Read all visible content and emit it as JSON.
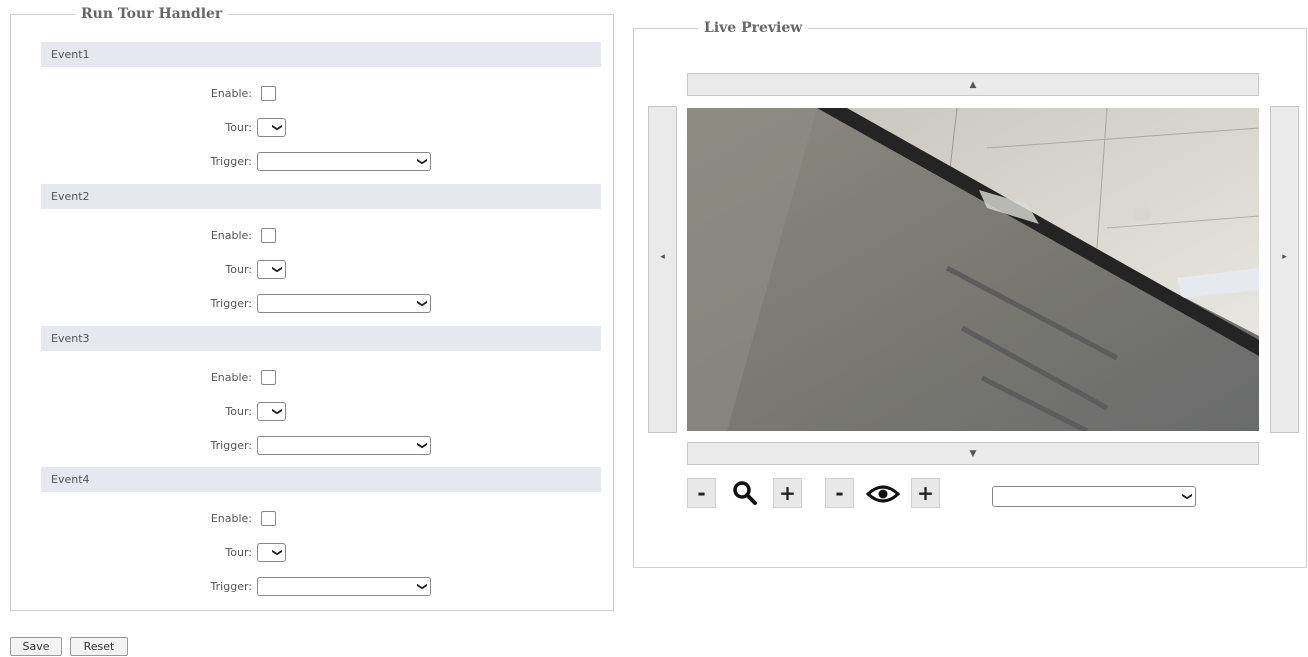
{
  "handler": {
    "title": "Run Tour Handler",
    "enable_label": "Enable:",
    "tour_label": "Tour:",
    "trigger_label": "Trigger:",
    "events": [
      {
        "name": "Event1",
        "trigger_value": ""
      },
      {
        "name": "Event2",
        "trigger_value": ""
      },
      {
        "name": "Event3",
        "trigger_value": ""
      },
      {
        "name": "Event4",
        "trigger_value": ""
      }
    ]
  },
  "preview": {
    "title": "Live Preview",
    "zoom_minus": "-",
    "zoom_plus": "+",
    "focus_minus": "-",
    "focus_plus": "+",
    "preset_value": ""
  },
  "buttons": {
    "save": "Save",
    "reset": "Reset"
  },
  "icons": {
    "zoom": "magnifier-icon",
    "focus": "eye-icon",
    "dropdown": "chevron-down-icon",
    "pan_up": "caret-up-icon",
    "pan_down": "caret-down-icon",
    "pan_left": "caret-left-icon",
    "pan_right": "caret-right-icon"
  }
}
